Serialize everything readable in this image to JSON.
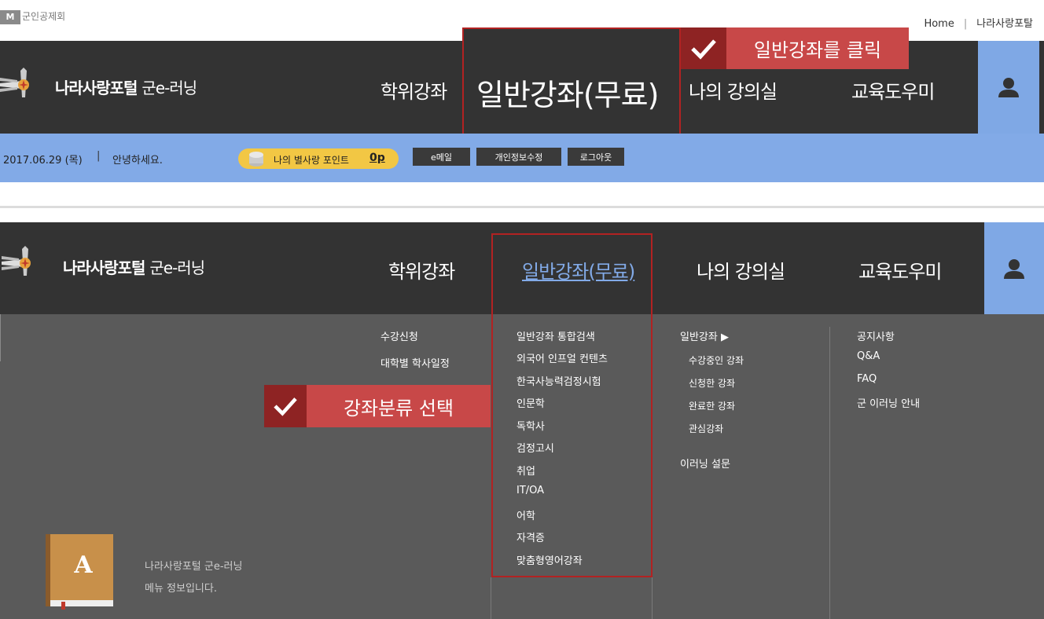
{
  "topbar": {
    "brand": "군인공제회",
    "brand_mark": "M",
    "links": [
      "Home",
      "나라사랑포탈"
    ],
    "link_sep": "|"
  },
  "site": {
    "logo_bold": "나라사랑포털",
    "logo_thin": "군e-러닝"
  },
  "nav": {
    "items": [
      "학위강좌",
      "일반강좌(무료)",
      "나의 강의실",
      "교육도우미"
    ],
    "user_icon": "user-icon"
  },
  "infobar": {
    "date": "2017.06.29 (목)",
    "sep": "|",
    "greeting": "안녕하세요.",
    "points_label": "나의 별사랑 포인트",
    "points_value": "0p",
    "buttons": [
      "e메일",
      "개인정보수정",
      "로그아웃"
    ]
  },
  "callouts": {
    "first": "일반강좌를 클릭",
    "second": "강좌분류 선택"
  },
  "menu": {
    "col1": [
      "수강신청",
      "대학별 학사일정"
    ],
    "col2": [
      "일반강좌 통합검색",
      "외국어 인프얼 컨텐츠",
      "한국사능력검정시험",
      "인문학",
      "독학사",
      "검정고시",
      "취업",
      "IT/OA",
      "어학",
      "자격증",
      "맞춤형영어강좌"
    ],
    "col3_head": "일반강좌 ▶",
    "col3": [
      "수강중인 강좌",
      "신청한 강좌",
      "완료한 강좌",
      "관심강좌"
    ],
    "col3_extra": "이러닝 설문",
    "col4": [
      "공지사항",
      "Q&A",
      "FAQ",
      "군 이러닝 안내"
    ],
    "info_line1": "나라사랑포털 군e-러닝",
    "info_line2": "메뉴 정보입니다.",
    "book_letter": "A"
  },
  "colors": {
    "header_dark": "#333333",
    "accent_blue": "#82aae7",
    "callout_red": "#c84848",
    "panel_gray": "#5a5a5a",
    "points_yellow": "#f2c744"
  }
}
